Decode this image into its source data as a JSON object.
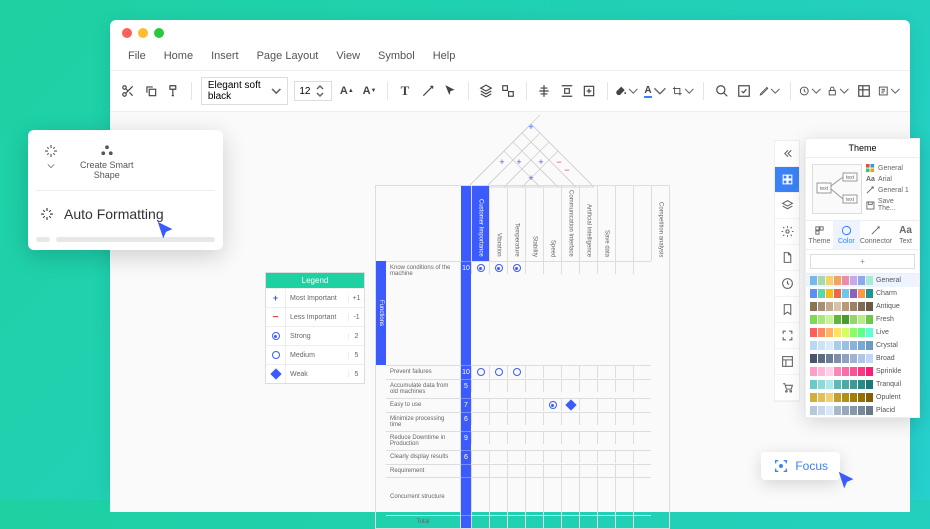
{
  "menu": [
    "File",
    "Home",
    "Insert",
    "Page Layout",
    "View",
    "Symbol",
    "Help"
  ],
  "toolbar": {
    "font": "Elegant soft black",
    "size": "12"
  },
  "popup": {
    "create": "Create Smart\nShape",
    "auto": "Auto Formatting"
  },
  "legend": {
    "title": "Legend",
    "rows": [
      {
        "label": "Most Important",
        "val": "+1"
      },
      {
        "label": "Less Important",
        "val": "-1"
      },
      {
        "label": "Strong",
        "val": "2"
      },
      {
        "label": "Medium",
        "val": "5"
      },
      {
        "label": "Weak",
        "val": "5"
      }
    ]
  },
  "qfd": {
    "columns": [
      "Customer Importance",
      "Vibration",
      "Temperature",
      "Stability",
      "Speed",
      "Communication Interface",
      "Artificial Intelligence",
      "Save data",
      "",
      "",
      "Competition analysis"
    ],
    "rows": [
      {
        "label": "Know conditions of the machine",
        "score": "10",
        "cells": [
          "strong",
          "strong",
          "strong",
          "",
          "",
          "",
          "",
          ""
        ]
      },
      {
        "label": "Prevent failures",
        "score": "10",
        "cells": [
          "med",
          "med",
          "med",
          "",
          "",
          "",
          "",
          ""
        ]
      },
      {
        "label": "Accumulate data from old machines",
        "score": "5",
        "cells": [
          "",
          "",
          "",
          "",
          "",
          "",
          "",
          ""
        ]
      },
      {
        "label": "Easy to use",
        "score": "7",
        "cells": [
          "",
          "",
          "",
          "",
          "strong",
          "weak",
          "",
          ""
        ]
      },
      {
        "label": "Minimize processing time",
        "score": "6",
        "cells": [
          "",
          "",
          "",
          "",
          "",
          "",
          "",
          ""
        ]
      },
      {
        "label": "Reduce Downtime in Production",
        "score": "9",
        "cells": [
          "",
          "",
          "",
          "",
          "",
          "",
          "",
          ""
        ]
      },
      {
        "label": "Clearly display results",
        "score": "6",
        "cells": [
          "",
          "",
          "",
          "",
          "",
          "",
          "",
          ""
        ]
      },
      {
        "label": "Requirement",
        "score": "",
        "cells": [
          "",
          "",
          "",
          "",
          "",
          "",
          "",
          ""
        ]
      }
    ],
    "concurrent": "Concurrent structure",
    "total": "Total"
  },
  "theme": {
    "title": "Theme",
    "props": [
      "General",
      "Arial",
      "General 1",
      "Save The..."
    ],
    "tabs": [
      "Theme",
      "Color",
      "Connector",
      "Text"
    ],
    "schemes": [
      "General",
      "Charm",
      "Antique",
      "Fresh",
      "Live",
      "Crystal",
      "Broad",
      "Sprinkle",
      "Tranquil",
      "Opulent",
      "Placid"
    ]
  },
  "focus": "Focus"
}
